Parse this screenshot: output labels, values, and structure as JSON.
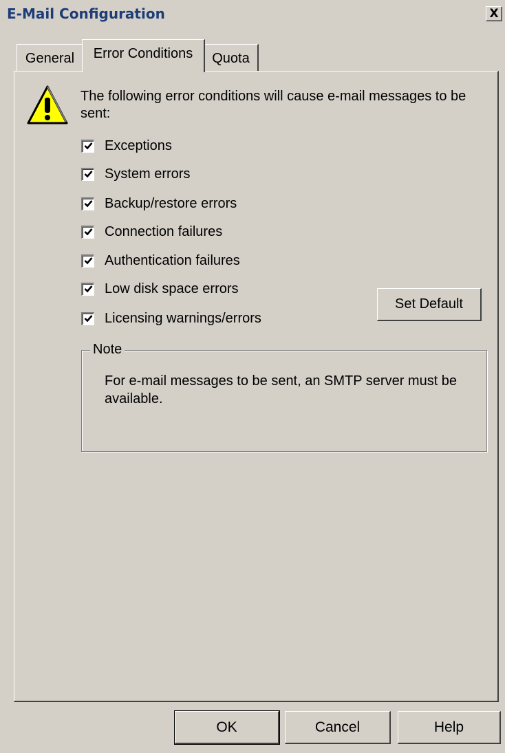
{
  "window": {
    "title": "E-Mail Configuration",
    "close_label": "X"
  },
  "tabs": [
    {
      "label": "General",
      "active": false
    },
    {
      "label": "Error Conditions",
      "active": true
    },
    {
      "label": "Quota",
      "active": false
    }
  ],
  "error_conditions": {
    "intro": "The following error conditions will cause e-mail messages to be sent:",
    "icon": "warning-icon",
    "checkboxes": [
      {
        "label": "Exceptions",
        "checked": true
      },
      {
        "label": "System errors",
        "checked": true
      },
      {
        "label": "Backup/restore errors",
        "checked": true
      },
      {
        "label": "Connection failures",
        "checked": true
      },
      {
        "label": "Authentication failures",
        "checked": true
      },
      {
        "label": "Low disk space errors",
        "checked": true
      },
      {
        "label": "Licensing warnings/errors",
        "checked": true
      }
    ],
    "set_default_label": "Set Default",
    "note": {
      "legend": "Note",
      "text": "For e-mail messages to be sent, an SMTP server must be available."
    }
  },
  "footer": {
    "ok_label": "OK",
    "cancel_label": "Cancel",
    "help_label": "Help"
  },
  "colors": {
    "dialog_background": "#d4d0c8",
    "title_text": "#1c3d78",
    "warning_yellow": "#ffff00"
  }
}
